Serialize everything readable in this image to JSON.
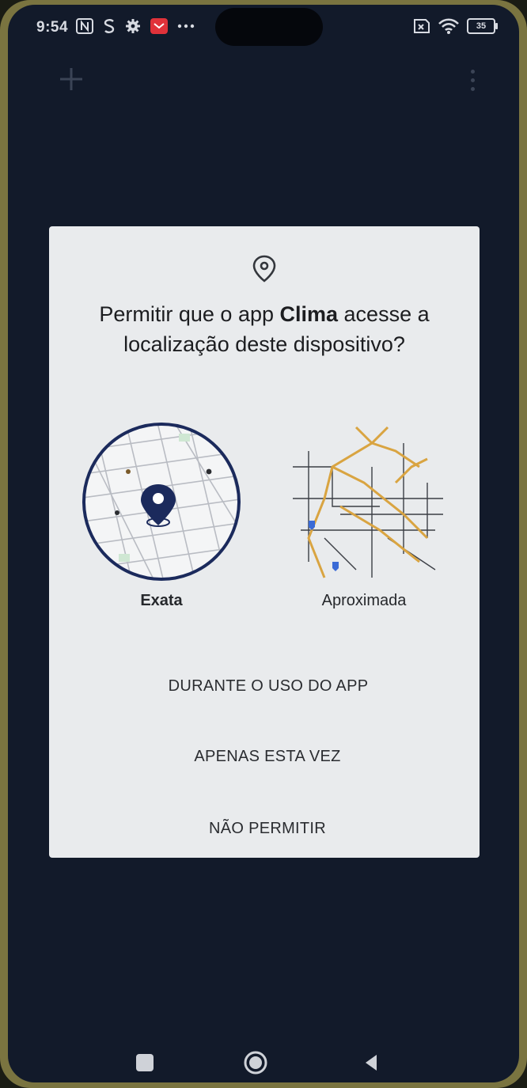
{
  "status_bar": {
    "time": "9:54",
    "battery": "35",
    "icons": [
      "nfc-icon",
      "s-icon",
      "settings-icon",
      "mail-icon",
      "more-icon",
      "sim-icon",
      "wifi-icon",
      "battery-icon"
    ]
  },
  "top_bar": {
    "add_icon": "plus-icon",
    "menu_icon": "more-vert-icon"
  },
  "dialog": {
    "title_pre": "Permitir que o app ",
    "title_app": "Clima",
    "title_post": " acesse a localização deste dispositivo?",
    "options": {
      "exact_label": "Exata",
      "approx_label": "Aproximada"
    },
    "buttons": {
      "while_using": "DURANTE O USO DO APP",
      "only_once": "APENAS ESTA VEZ",
      "deny": "NÃO PERMITIR"
    }
  },
  "nav": {
    "recents": "recents-icon",
    "home": "home-icon",
    "back": "back-icon"
  },
  "colors": {
    "screen_bg": "#121a2a",
    "dialog_bg": "#e9ebed",
    "pin_dark": "#1b2a5c",
    "road_orange": "#d9a441"
  }
}
